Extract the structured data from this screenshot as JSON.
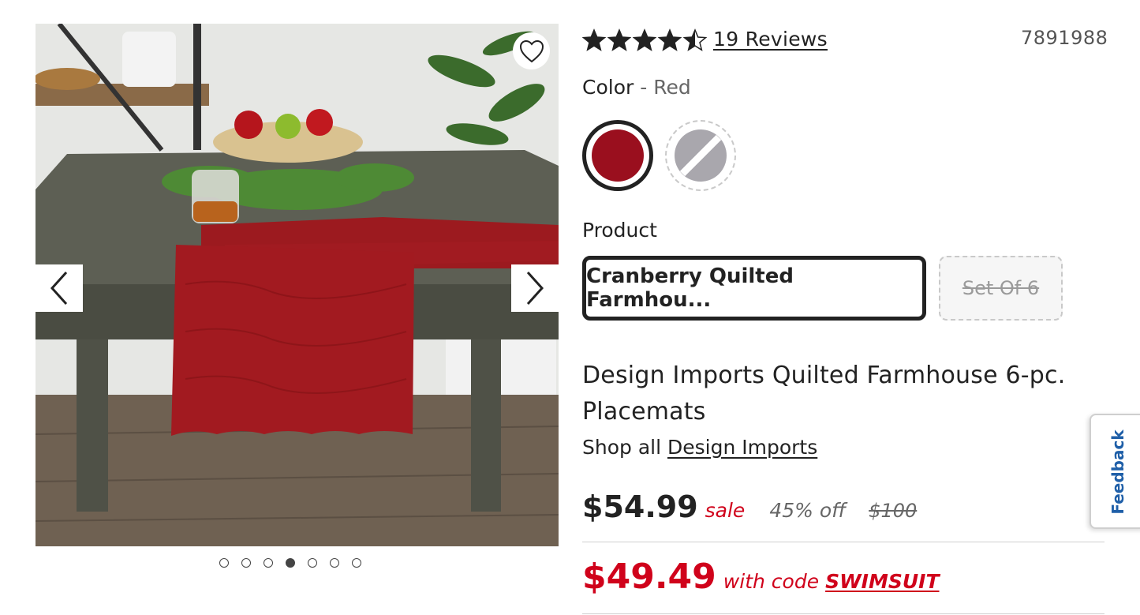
{
  "gallery": {
    "favorite_icon": "heart-outline-icon",
    "prev_icon": "chevron-left-icon",
    "next_icon": "chevron-right-icon",
    "dots_count": 7,
    "active_dot_index": 3
  },
  "rating": {
    "stars": 4.5,
    "reviews_label": "19 Reviews"
  },
  "sku": "7891988",
  "color": {
    "label": "Color",
    "separator": " - ",
    "value": "Red",
    "swatches": [
      {
        "name": "Red",
        "hex": "#9a0f1e",
        "selected": true,
        "available": true
      },
      {
        "name": "Gray",
        "hex": "#a9a7ad",
        "selected": false,
        "available": false
      }
    ]
  },
  "product": {
    "label": "Product",
    "options": [
      {
        "label": "Cranberry Quilted Farmhou...",
        "selected": true,
        "available": true
      },
      {
        "label": "Set Of 6",
        "selected": false,
        "available": false
      }
    ]
  },
  "title": "Design Imports Quilted Farmhouse 6-pc. Placemats",
  "shop_all": {
    "prefix": "Shop all",
    "brand": "Design Imports"
  },
  "pricing": {
    "price": "$54.99",
    "sale_label": "sale",
    "discount": "45% off",
    "original": "$100",
    "code_price": "$49.49",
    "code_text": "with code",
    "code": "SWIMSUIT"
  },
  "feedback_label": "Feedback",
  "colors": {
    "accent_red": "#d0021b",
    "text": "#222222",
    "feedback_blue": "#1f5fa8"
  }
}
